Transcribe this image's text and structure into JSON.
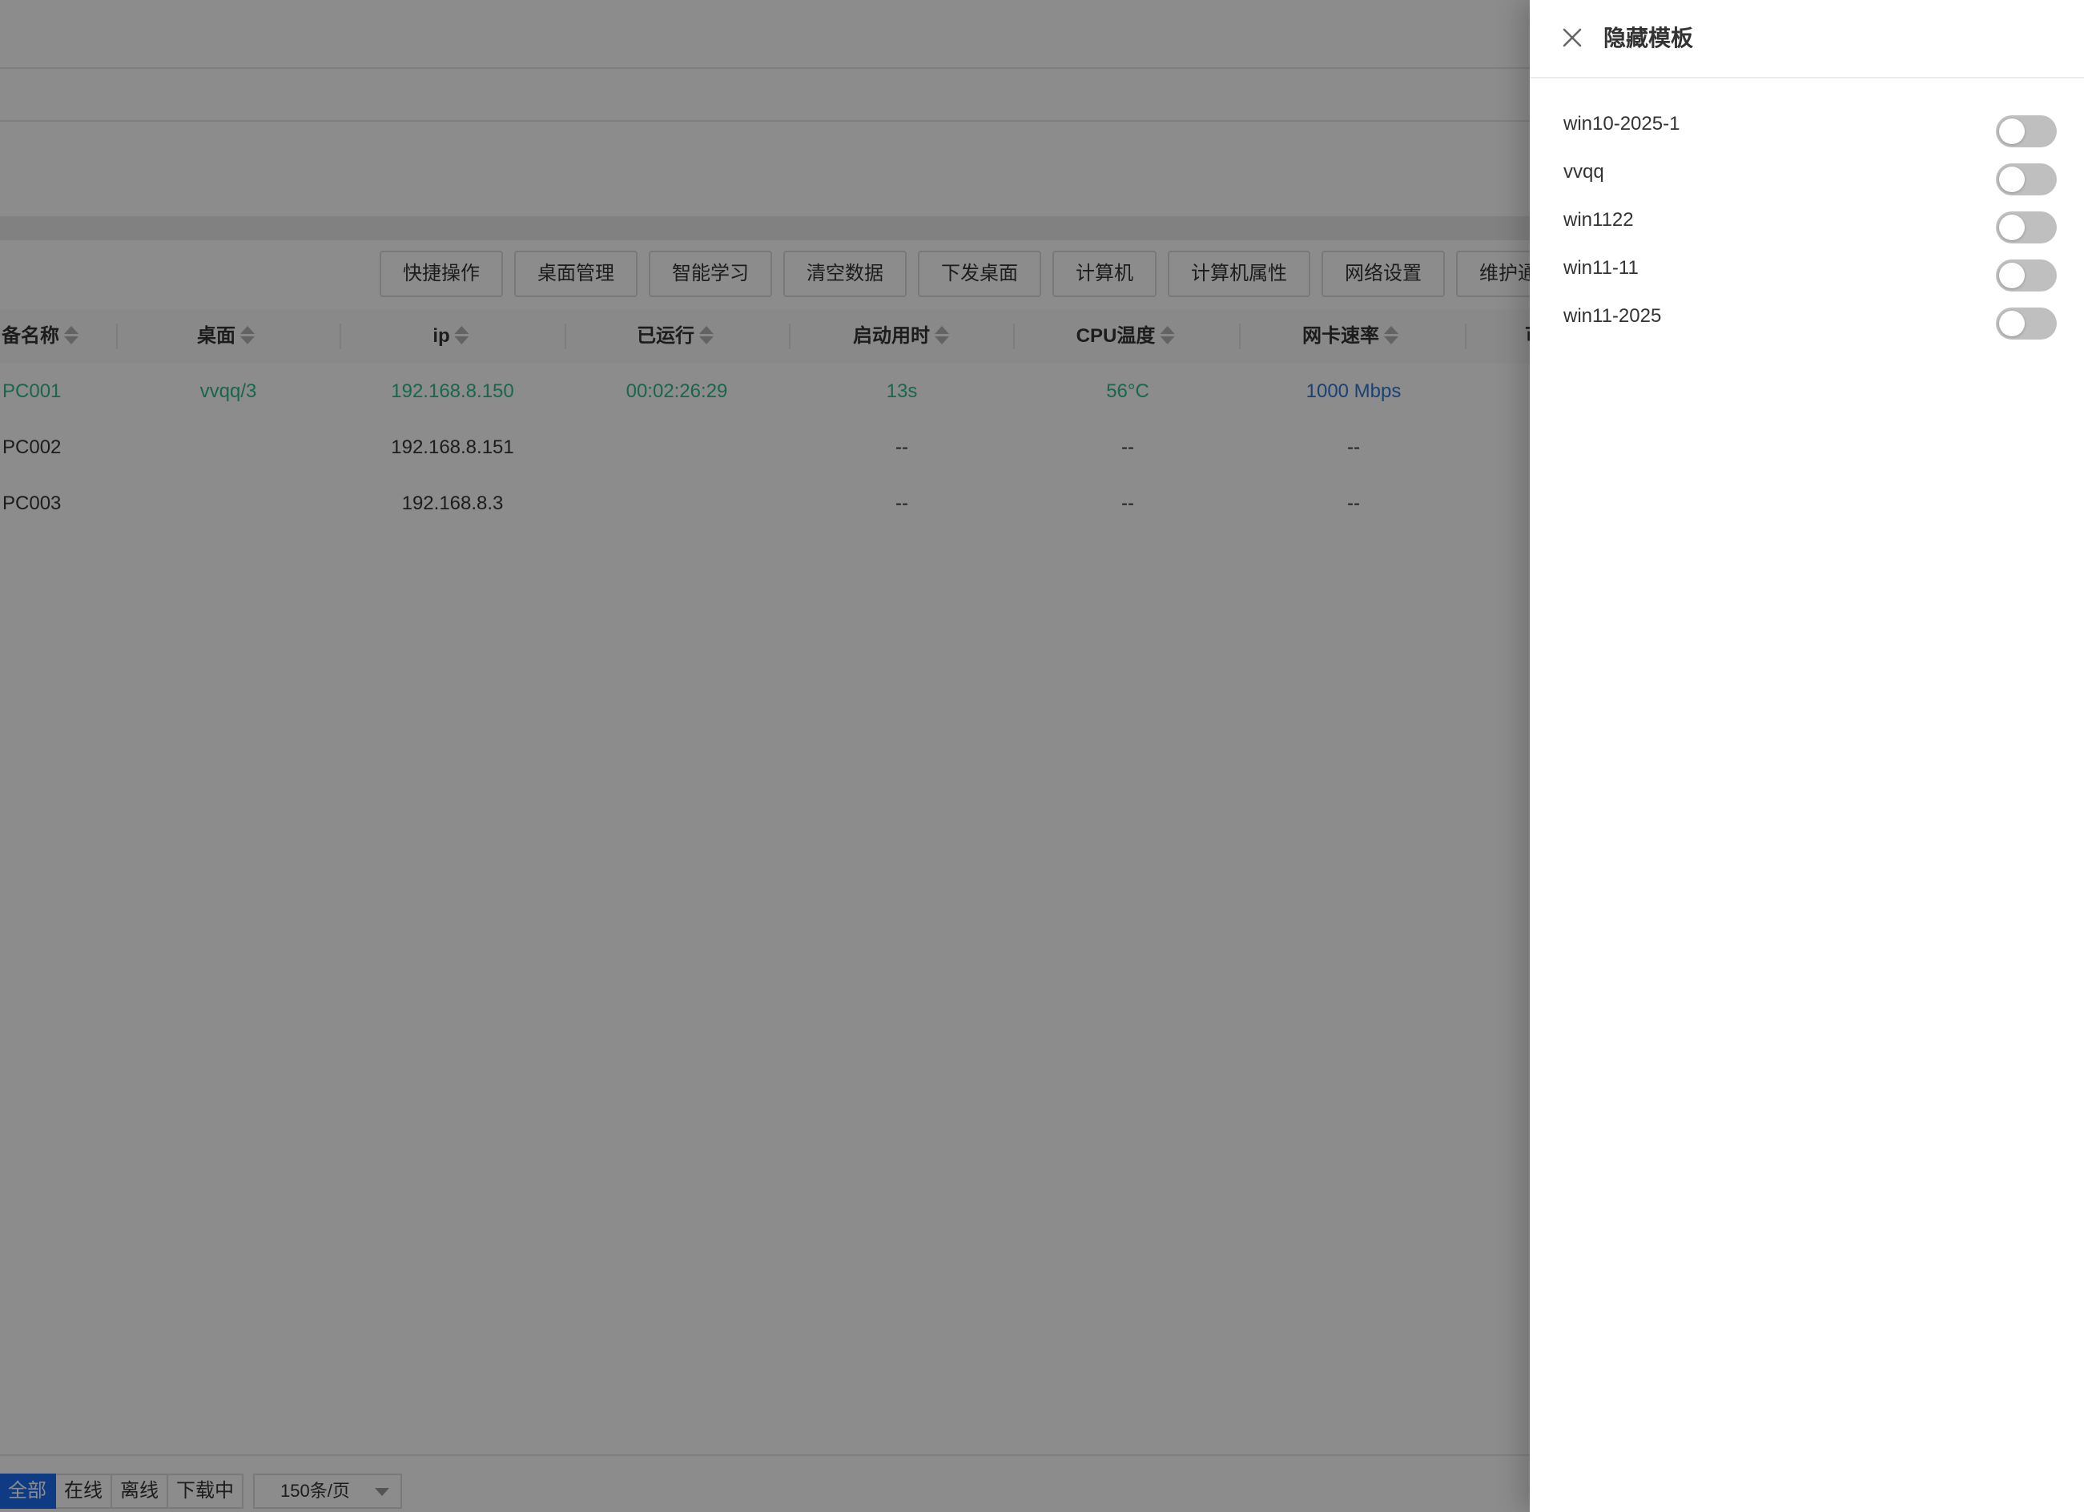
{
  "toolbar": {
    "buttons": [
      "快捷操作",
      "桌面管理",
      "智能学习",
      "清空数据",
      "下发桌面",
      "计算机",
      "计算机属性",
      "网络设置",
      "维护通"
    ]
  },
  "table": {
    "columns": [
      "备名称",
      "桌面",
      "ip",
      "已运行",
      "启动用时",
      "CPU温度",
      "网卡速率",
      "可"
    ],
    "rows": [
      {
        "name": "PC001",
        "desktop": "vvqq/3",
        "ip": "192.168.8.150",
        "uptime": "00:02:26:29",
        "boot_time": "13s",
        "cpu_temp": "56°C",
        "nic_speed": "1000 Mbps",
        "status": "online"
      },
      {
        "name": "PC002",
        "desktop": "",
        "ip": "192.168.8.151",
        "uptime": "",
        "boot_time": "--",
        "cpu_temp": "--",
        "nic_speed": "--",
        "status": "offline"
      },
      {
        "name": "PC003",
        "desktop": "",
        "ip": "192.168.8.3",
        "uptime": "",
        "boot_time": "--",
        "cpu_temp": "--",
        "nic_speed": "--",
        "status": "offline"
      }
    ]
  },
  "filters": {
    "items": [
      "全部",
      "在线",
      "离线",
      "下载中"
    ],
    "active": "全部",
    "page_size": "150条/页"
  },
  "drawer": {
    "title": "隐藏模板",
    "templates": [
      {
        "name": "win10-2025-1",
        "hidden": false
      },
      {
        "name": "vvqq",
        "hidden": false
      },
      {
        "name": "win1122",
        "hidden": false
      },
      {
        "name": "win11-11",
        "hidden": false
      },
      {
        "name": "win11-2025",
        "hidden": false
      }
    ]
  },
  "colors": {
    "online_text": "#2fb88d",
    "speed_text": "#2f78d4",
    "active_filter": "#1a6cf0",
    "switch_off": "#bfbfbf"
  }
}
